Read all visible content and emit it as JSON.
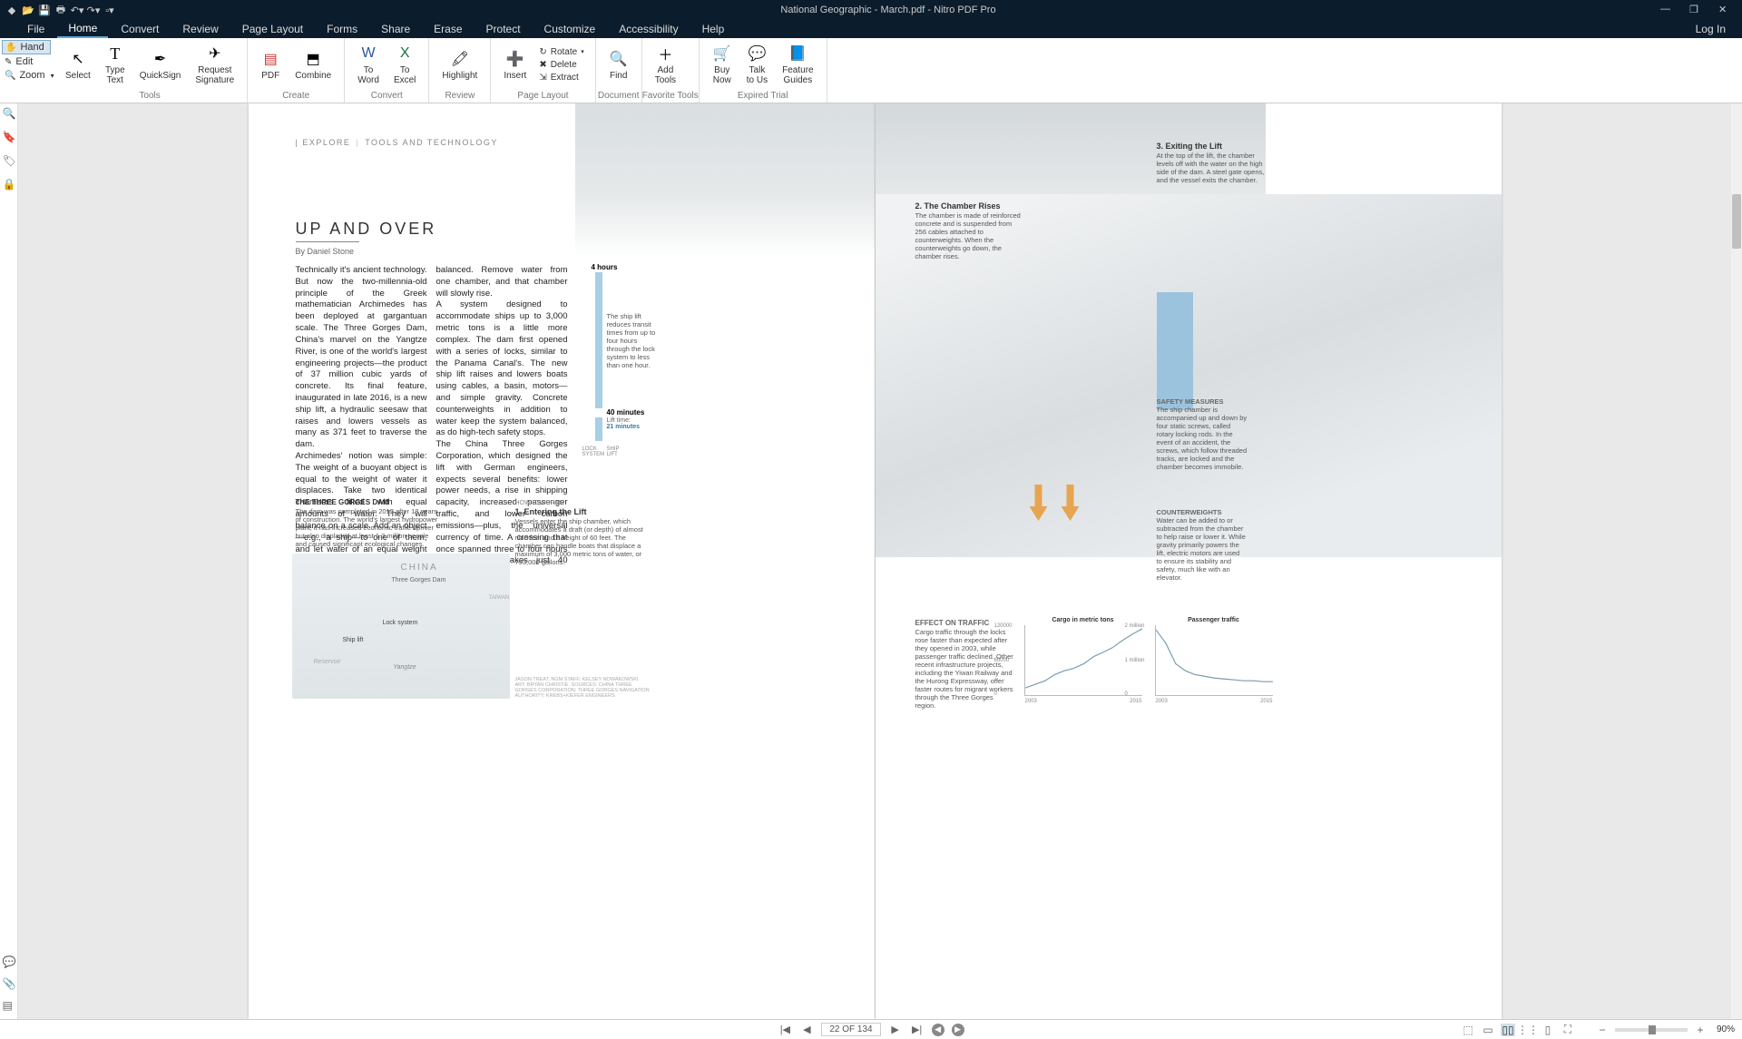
{
  "title": "National Geographic - March.pdf - Nitro PDF Pro",
  "menu": {
    "file": "File",
    "home": "Home",
    "convert": "Convert",
    "review": "Review",
    "pagelayout": "Page Layout",
    "forms": "Forms",
    "share": "Share",
    "erase": "Erase",
    "protect": "Protect",
    "customize": "Customize",
    "accessibility": "Accessibility",
    "help": "Help",
    "login": "Log In"
  },
  "ribbon_left": {
    "hand": "Hand",
    "edit": "Edit",
    "zoom": "Zoom"
  },
  "ribbon": {
    "tools_grp": "Tools",
    "create_grp": "Create",
    "convert_grp": "Convert",
    "review_grp": "Review",
    "pagelayout_grp": "Page Layout",
    "document_grp": "Document",
    "fav_grp": "Favorite Tools",
    "trial_grp": "Expired Trial",
    "select": "Select",
    "typetext": "Type\nText",
    "quicksign": "QuickSign",
    "reqsig": "Request\nSignature",
    "pdf": "PDF",
    "combine": "Combine",
    "toword": "To\nWord",
    "toexcel": "To\nExcel",
    "highlight": "Highlight",
    "insert": "Insert",
    "rotate": "Rotate",
    "delete": "Delete",
    "extract": "Extract",
    "find": "Find",
    "addtools": "Add\nTools",
    "buynow": "Buy\nNow",
    "talktous": "Talk\nto Us",
    "featureguides": "Feature\nGuides"
  },
  "page_indicator": "22 OF 134",
  "zoom_pct": "90%",
  "article": {
    "crumb1": "EXPLORE",
    "crumb2": "TOOLS AND TECHNOLOGY",
    "title": "UP AND OVER",
    "byline": "By Daniel Stone",
    "col1": "Technically it's ancient technology. But now the two-millennia-old principle of the Greek mathematician Archimedes has been deployed at gargantuan scale. The Three Gorges Dam, China's marvel on the Yangtze River, is one of the world's largest engineering projects—the product of 37 million cubic yards of concrete. Its final feature, inaugurated in late 2016, is a new ship lift, a hydraulic seesaw that raises and lowers vessels as many as 371 feet to traverse the dam.\n    Archimedes' notion was simple: The weight of a buoyant object is equal to the weight of water it displaces. Take two identical chambers filled with equal amounts of water. They will balance on a scale. Add an object—e.g., a ship—to one of them, and let water of an equal weight out. The two chambers will remain",
    "col2": "balanced. Remove water from one chamber, and that chamber will slowly rise.\n    A system designed to accommodate ships up to 3,000 metric tons is a little more complex. The dam first opened with a series of locks, similar to the Panama Canal's. The new ship lift raises and lowers boats using cables, a basin, motors—and simple gravity. Concrete counterweights in addition to water keep the system balanced, as do high-tech safety stops.\n    The China Three Gorges Corporation, which designed the lift with German engineers, expects several benefits: lower power needs, a rise in shipping capacity, increased passenger traffic, and lower carbon emissions—plus, the universal currency of time. A crossing that once spanned three to four hours via locks now takes just 40 minutes.",
    "time_4h": "4 hours",
    "time_40m": "40 minutes",
    "lift_time_lbl": "Lift time:",
    "lift_time_val": "21 minutes",
    "lock_system": "LOCK\nSYSTEM",
    "ship_lift": "SHIP\nLIFT",
    "transit_note": "The ship lift reduces transit times from up to four hours through the lock system to less than one hour.",
    "tgd_title": "THE THREE GORGES DAM",
    "tgd_body": "The dam was completed in 2012 after 18 years of construction. The world's largest hydropower plant, it has increased economic traffic upriver but also displaced at least 1.3 million people and caused significant ecological changes.",
    "map": {
      "china": "CHINA",
      "tgd": "Three Gorges Dam",
      "taiwan": "TAIWAN",
      "lock": "Lock system",
      "shiplift": "Ship lift",
      "yangtze": "Yangtze",
      "reservoir": "Reservoir"
    },
    "hiw_lbl": "HOW IT WORKS",
    "hiw_title": "1. Entering the Lift",
    "hiw_body": "Vessels enter the ship chamber, which accommodates a draft (or depth) of almost nine feet and a height of 60 feet. The chamber can handle boats that displace a maximum of 3,000 metric tons of water, or 793,000 gallons.",
    "credit": "JASON TREAT, NGM STAFF; KELSEY NOWAKOWSKI\nART: BRYAN CHRISTIE. SOURCES: CHINA THREE GORGES CORPORATION; THREE GORGES NAVIGATION AUTHORITY; KREBS+KIEFER ENGINEERS",
    "step2_title": "2. The Chamber Rises",
    "step2_body": "The chamber is made of reinforced concrete and is suspended from 256 cables attached to counterweights. When the counterweights go down, the chamber rises.",
    "step3_title": "3. Exiting the Lift",
    "step3_body": "At the top of the lift, the chamber levels off with the water on the high side of the dam. A steel gate opens, and the vessel exits the chamber.",
    "safety_title": "SAFETY MEASURES",
    "safety_body": "The ship chamber is accompanied up and down by four static screws, called rotary locking rods. In the event of an accident, the screws, which follow threaded tracks, are locked and the chamber becomes immobile.",
    "cw_title": "COUNTERWEIGHTS",
    "cw_body": "Water can be added to or subtracted from the chamber to help raise or lower it. While gravity primarily powers the lift, electric motors are used to ensure its stability and safety, much like with an elevator.",
    "traffic_title": "EFFECT ON TRAFFIC",
    "traffic_body": "Cargo traffic through the locks rose faster than expected after they opened in 2003, while passenger traffic declined. Other recent infrastructure projects, including the Yiwan Railway and the Hurong Expressway, offer faster routes for migrant workers through the Three Gorges region."
  },
  "chart_data": [
    {
      "type": "line",
      "title": "Cargo in metric tons",
      "xlabel": "",
      "ylabel": "",
      "x_ticks": [
        "2003",
        "2015"
      ],
      "y_ticks": [
        0,
        60000,
        120000
      ],
      "ylim": [
        0,
        120000
      ],
      "x": [
        2003,
        2004,
        2005,
        2006,
        2007,
        2008,
        2009,
        2010,
        2011,
        2012,
        2013,
        2014,
        2015
      ],
      "values": [
        12000,
        18000,
        25000,
        35000,
        42000,
        48000,
        55000,
        68000,
        75000,
        82000,
        95000,
        105000,
        115000
      ]
    },
    {
      "type": "line",
      "title": "Passenger traffic",
      "xlabel": "",
      "ylabel": "",
      "x_ticks": [
        "2003",
        "2015"
      ],
      "y_ticks": [
        0,
        "1 million",
        "2 million"
      ],
      "ylim": [
        0,
        2000000
      ],
      "x": [
        2003,
        2004,
        2005,
        2006,
        2007,
        2008,
        2009,
        2010,
        2011,
        2012,
        2013,
        2014,
        2015
      ],
      "values": [
        1900000,
        1500000,
        900000,
        700000,
        600000,
        550000,
        500000,
        480000,
        450000,
        430000,
        420000,
        410000,
        400000
      ]
    }
  ]
}
